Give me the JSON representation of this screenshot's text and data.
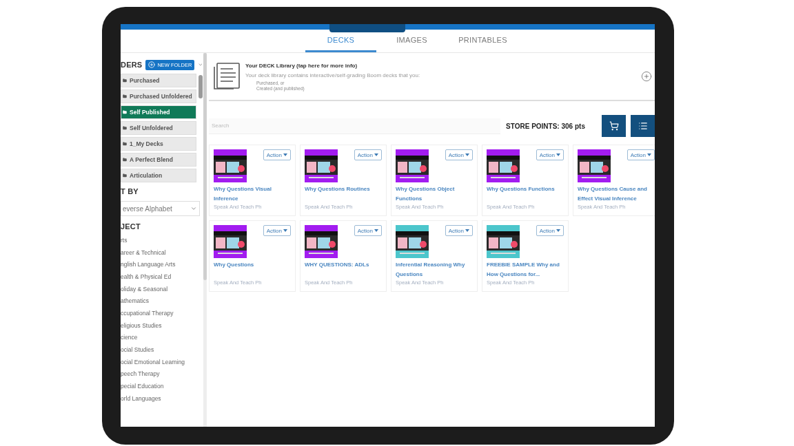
{
  "tabs": [
    {
      "label": "DECKS",
      "selected": true
    },
    {
      "label": "IMAGES",
      "selected": false
    },
    {
      "label": "PRINTABLES",
      "selected": false
    }
  ],
  "folders": {
    "heading": "DERS",
    "new_button": "NEW FOLDER",
    "items": [
      {
        "label": "Purchased",
        "selected": false
      },
      {
        "label": "Purchased Unfoldered",
        "selected": false
      },
      {
        "label": "Self Published",
        "selected": true
      },
      {
        "label": "Self Unfoldered",
        "selected": false
      },
      {
        "label": "1_My Decks",
        "selected": false
      },
      {
        "label": "A Perfect Blend",
        "selected": false
      },
      {
        "label": "Articulation",
        "selected": false
      }
    ]
  },
  "sort": {
    "heading": "T BY",
    "value": "everse Alphabet"
  },
  "subjects": {
    "heading": "JECT",
    "items": [
      "rts",
      "areer & Technical",
      "nglish Language Arts",
      "ealth & Physical Ed",
      "oliday & Seasonal",
      "athematics",
      "ccupational Therapy",
      "eligious Studies",
      "cience",
      "ocial Studies",
      "ocial Emotional Learning",
      "peech Therapy",
      "pecial Education",
      "orld Languages"
    ]
  },
  "library_info": {
    "title": "Your DECK Library (tap here for more info)",
    "description": "Your deck library contains interactive/self-grading Boom decks that you:",
    "points": [
      "Purchased, or",
      "Created (and published)"
    ]
  },
  "search": {
    "placeholder": "Search"
  },
  "store_points": "STORE POINTS: 306 pts",
  "decks": [
    {
      "title": "Why Questions Visual Inference",
      "author": "Speak And Teach Ph",
      "action": "Action",
      "color": "#a21cf0"
    },
    {
      "title": "Why Questions Routines",
      "author": "Speak And Teach Ph",
      "action": "Action",
      "color": "#a21cf0"
    },
    {
      "title": "Why Questions Object Functions",
      "author": "Speak And Teach Ph",
      "action": "Action",
      "color": "#a21cf0"
    },
    {
      "title": "Why Questions Functions",
      "author": "Speak And Teach Ph",
      "action": "Action",
      "color": "#a21cf0"
    },
    {
      "title": "Why Questions Cause and Effect Visual Inference",
      "author": "Speak And Teach Ph",
      "action": "Action",
      "color": "#a21cf0"
    },
    {
      "title": "Why Questions",
      "author": "Speak And Teach Ph",
      "action": "Action",
      "color": "#a21cf0"
    },
    {
      "title": "WHY QUESTIONS: ADLs",
      "author": "Speak And Teach Ph",
      "action": "Action",
      "color": "#a21cf0"
    },
    {
      "title": "Inferential Reasoning Why Questions",
      "author": "Speak And Teach Ph",
      "action": "Action",
      "color": "#4cc6cc"
    },
    {
      "title": "FREEBIE SAMPLE Why and How Questions for...",
      "author": "Speak And Teach Ph",
      "action": "Action",
      "color": "#4cc6cc"
    }
  ]
}
